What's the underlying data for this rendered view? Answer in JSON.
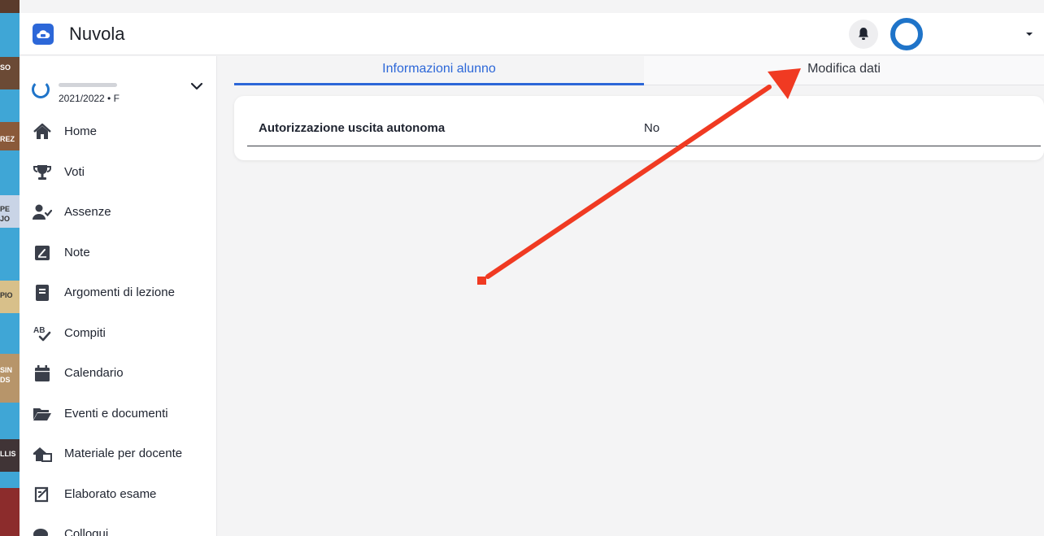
{
  "app": {
    "title": "Nuvola"
  },
  "colors": {
    "accent": "#2c67d8",
    "avatar_ring": "#1f74c9",
    "annotation_arrow": "#f03a22"
  },
  "header": {
    "bell_icon": "bell-icon",
    "avatar_icon": "avatar-icon",
    "menu_icon": "caret-down-icon"
  },
  "student_selector": {
    "year_label": "2021/2022 • F",
    "chevron_icon": "chevron-down-icon"
  },
  "sidebar": {
    "items": [
      {
        "label": "Home",
        "icon": "home-icon"
      },
      {
        "label": "Voti",
        "icon": "trophy-icon"
      },
      {
        "label": "Assenze",
        "icon": "user-check-icon"
      },
      {
        "label": "Note",
        "icon": "note-icon"
      },
      {
        "label": "Argomenti di lezione",
        "icon": "book-icon"
      },
      {
        "label": "Compiti",
        "icon": "spellcheck-icon"
      },
      {
        "label": "Calendario",
        "icon": "calendar-icon"
      },
      {
        "label": "Eventi e documenti",
        "icon": "folder-open-icon"
      },
      {
        "label": "Materiale per docente",
        "icon": "teacher-material-icon"
      },
      {
        "label": "Elaborato esame",
        "icon": "exam-icon"
      },
      {
        "label": "Colloqui",
        "icon": "chat-icon"
      }
    ]
  },
  "tabs": [
    {
      "label": "Informazioni alunno",
      "active": true
    },
    {
      "label": "Modifica dati",
      "active": false
    }
  ],
  "info": {
    "rows": [
      {
        "label": "Autorizzazione uscita autonoma",
        "value": "No"
      }
    ]
  },
  "background": {
    "fragments": [
      "SO",
      "REZ",
      "PE",
      "JO",
      "PIO",
      "SIN",
      "DS",
      "LLIS"
    ]
  }
}
